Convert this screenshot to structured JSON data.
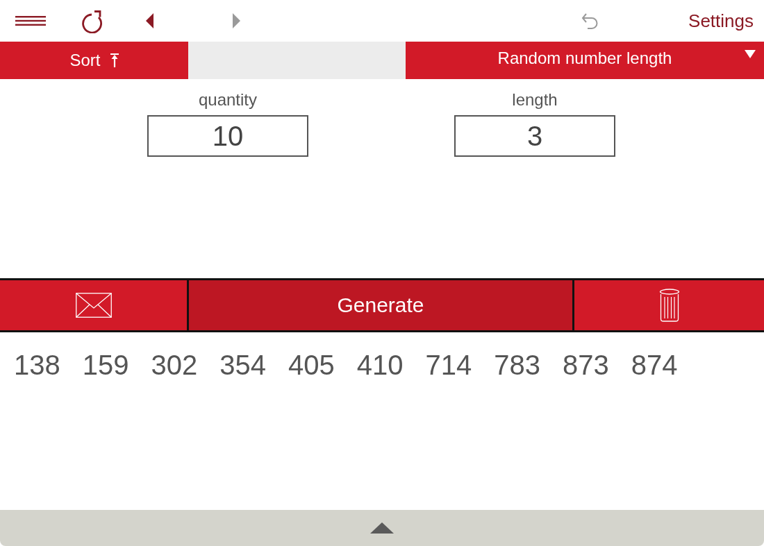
{
  "toolbar": {
    "left": [
      {
        "kind": "menu"
      },
      {
        "kind": "reload"
      },
      {
        "kind": "back",
        "disabled": false
      },
      {
        "kind": "forward",
        "disabled": true
      }
    ],
    "right": [
      {
        "kind": "undo",
        "disabled": true
      }
    ],
    "settings": "Settings"
  },
  "options_bar": {
    "sort": {
      "label": "Sort",
      "ascending": true
    },
    "mode": {
      "label": "Random number length"
    }
  },
  "fields": [
    {
      "label": "quantity",
      "value": "10"
    },
    {
      "label": "length",
      "value": "3"
    }
  ],
  "actions": [
    {
      "kind": "mail"
    },
    {
      "kind": "generate",
      "label": "Generate"
    },
    {
      "kind": "delete"
    }
  ],
  "results": [
    "138",
    "159",
    "302",
    "354",
    "405",
    "410",
    "714",
    "783",
    "873",
    "874"
  ],
  "drawer": {
    "expanded": false
  }
}
